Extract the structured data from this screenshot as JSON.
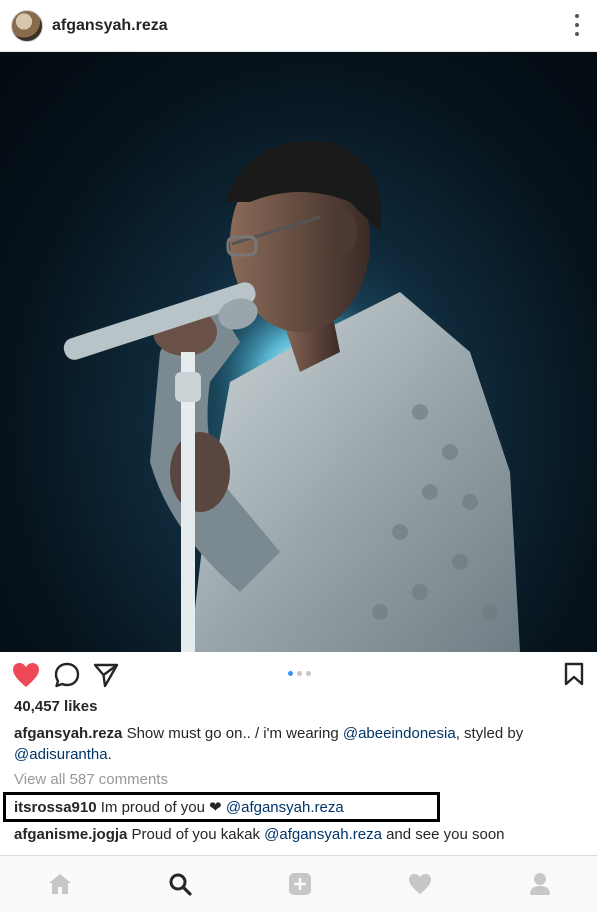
{
  "header": {
    "username": "afgansyah.reza",
    "more_icon": "more-vertical-icon"
  },
  "post": {
    "liked": true,
    "like_color": "#ed4956",
    "carousel_dots": 3,
    "carousel_active": 1
  },
  "likes_text": "40,457 likes",
  "caption": {
    "username": "afgansyah.reza",
    "text_1": "Show must go on.. / i'm wearing ",
    "mention_1": "@abeeindonesia",
    "text_2": ", styled by ",
    "mention_2": "@adisurantha",
    "text_3": "."
  },
  "view_all_comments": "View all 587 comments",
  "comments": [
    {
      "username": "itsrossa910",
      "text": "Im proud of you ❤ ",
      "mention": "@afgansyah.reza",
      "tail": ""
    },
    {
      "username": "afganisme.jogja",
      "text": "Proud of you kakak ",
      "mention": "@afgansyah.reza",
      "tail": " and see you soon"
    }
  ],
  "colors": {
    "mention": "#003569",
    "muted": "#999999",
    "text": "#262626"
  },
  "nav": [
    "home-icon",
    "search-icon",
    "add-icon",
    "activity-heart-icon",
    "profile-icon"
  ]
}
